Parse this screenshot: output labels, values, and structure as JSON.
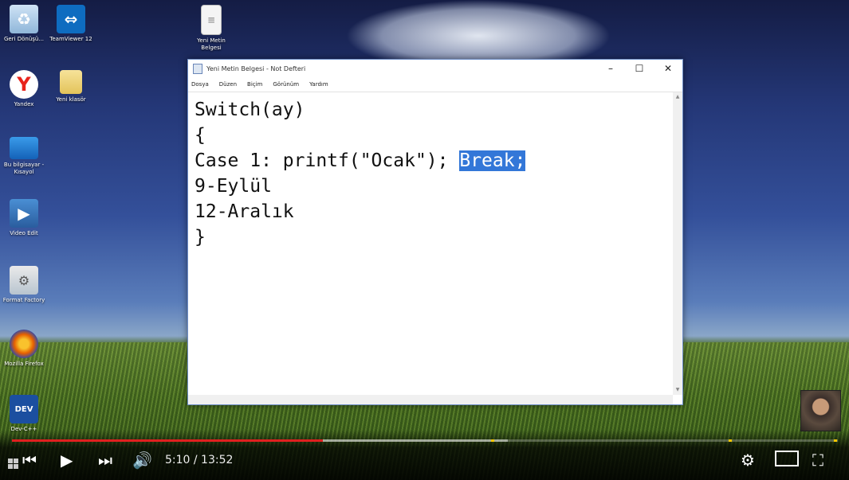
{
  "desktop": {
    "icons": [
      {
        "label": "Geri Dönüşü..."
      },
      {
        "label": "TeamViewer 12"
      },
      {
        "label": "Yeni Metin Belgesi"
      },
      {
        "label": "Yandex"
      },
      {
        "label": "Yeni klasör"
      },
      {
        "label": "Bu bilgisayar - Kısayol"
      },
      {
        "label": "Video Edit"
      },
      {
        "label": "Format Factory"
      },
      {
        "label": "Mozilla Firefox"
      },
      {
        "label": "Dev-C++"
      }
    ]
  },
  "notepad": {
    "title": "Yeni Metin Belgesi - Not Defteri",
    "menu": [
      "Dosya",
      "Düzen",
      "Biçim",
      "Görünüm",
      "Yardım"
    ],
    "lines": {
      "l1": "Switch(ay)",
      "l2": "{",
      "l3_prefix": "Case 1: printf(\"Ocak\"); ",
      "l3_selected": "Break;",
      "l4": "9-Eylül",
      "l5": "12-Aralık",
      "l6": "}"
    }
  },
  "player": {
    "time_display": "5:10 / 13:52",
    "progress_played": 0.376,
    "progress_buffered": 0.6,
    "colors": {
      "played": "#e02020",
      "ad_marker": "#f7c600"
    }
  }
}
